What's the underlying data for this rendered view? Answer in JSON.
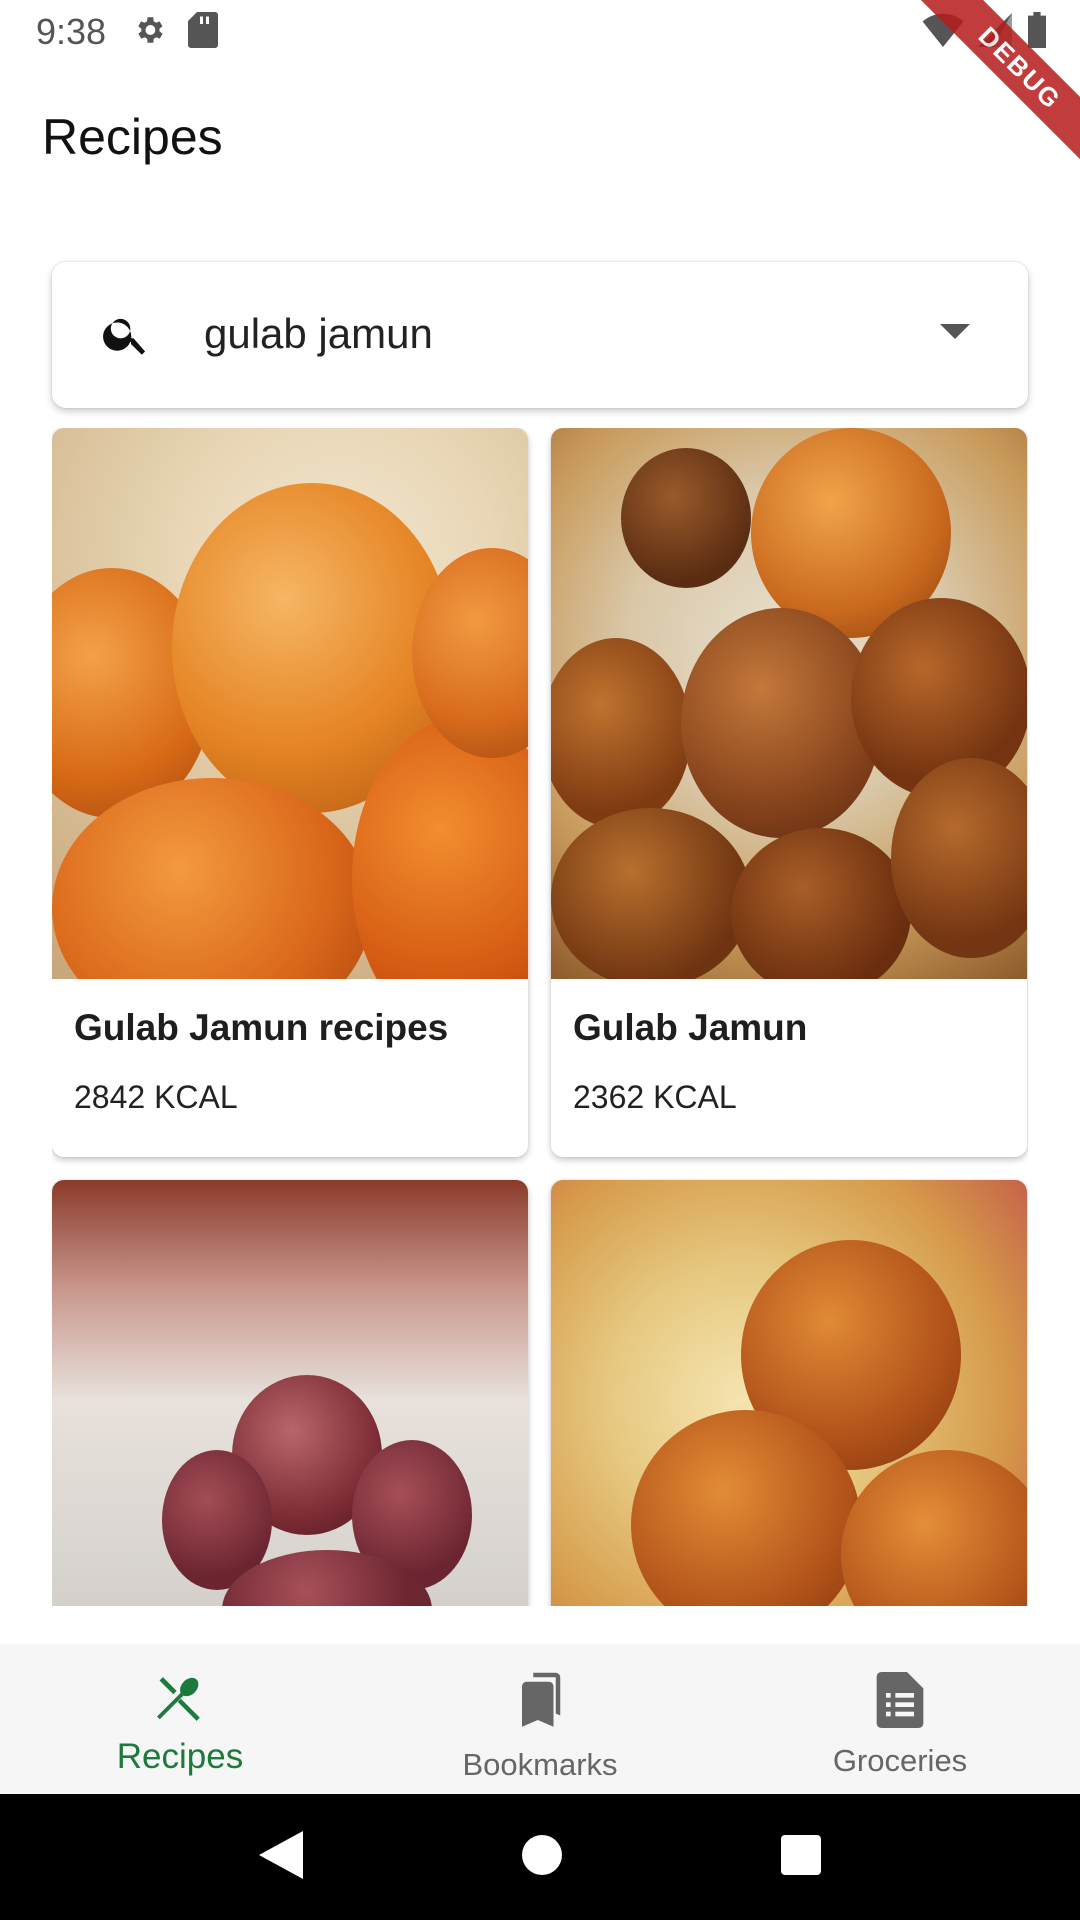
{
  "status_bar": {
    "time": "9:38",
    "left_icons": [
      "gear-icon",
      "sd-card-icon"
    ],
    "right_icons": [
      "wifi-icon",
      "cell-signal-icon",
      "battery-icon"
    ]
  },
  "debug_banner": "DEBUG",
  "app_bar": {
    "title": "Recipes"
  },
  "search": {
    "icon": "search-icon",
    "value": "gulab jamun",
    "dropdown_icon": "dropdown-arrow-icon"
  },
  "recipes": [
    {
      "title": "Gulab Jamun recipes",
      "calories": "2842 KCAL"
    },
    {
      "title": "Gulab Jamun",
      "calories": "2362 KCAL"
    },
    {
      "title": "",
      "calories": ""
    },
    {
      "title": "",
      "calories": ""
    }
  ],
  "bottom_nav": {
    "items": [
      {
        "label": "Recipes",
        "icon": "fork-knife-icon",
        "active": true
      },
      {
        "label": "Bookmarks",
        "icon": "bookmarks-icon",
        "active": false
      },
      {
        "label": "Groceries",
        "icon": "list-icon",
        "active": false
      }
    ]
  },
  "colors": {
    "accent": "#1b7a3c",
    "inactive": "#666666",
    "debug": "#b71c1c"
  },
  "system_nav": [
    "back-icon",
    "home-icon",
    "recents-icon"
  ]
}
